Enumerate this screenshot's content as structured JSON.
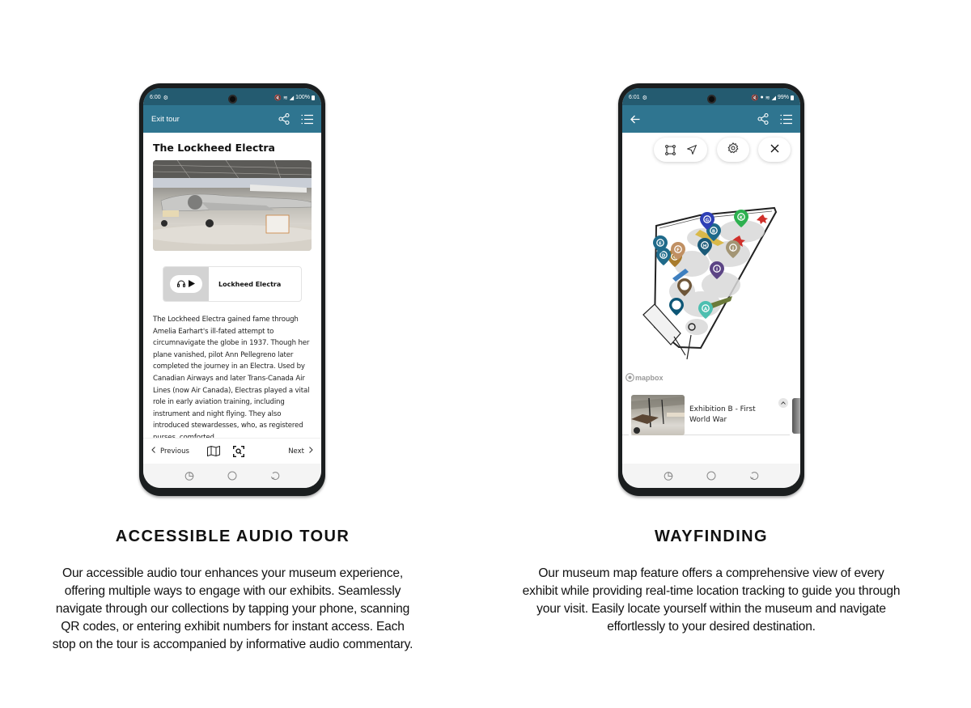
{
  "audio_tour_phone": {
    "status_bar": {
      "time": "6:00",
      "battery": "100%"
    },
    "app_bar": {
      "title": "Exit tour",
      "icons": [
        "share-icon",
        "list-icon"
      ]
    },
    "exhibit": {
      "title": "The Lockheed Electra",
      "image_alt": "Lockheed Electra aircraft on display",
      "audio_player": {
        "label": "Lockheed Electra",
        "icons": [
          "headphones-icon",
          "play-icon"
        ]
      },
      "description": "The Lockheed Electra gained fame through Amelia Earhart's ill-fated attempt to circumnavigate the globe in 1937. Though her plane vanished, pilot Ann Pellegreno later completed the journey in an Electra. Used by Canadian Airways and later Trans-Canada Air Lines (now Air Canada), Electras played a vital role in early aviation training, including instrument and night flying. They also introduced stewardesses, who, as registered nurses, comforted"
    },
    "bottom_nav": {
      "previous": "Previous",
      "next": "Next",
      "icons": [
        "chevron-left-icon",
        "map-icon",
        "scan-icon",
        "chevron-right-icon"
      ]
    },
    "system_nav": [
      "recents-icon",
      "home-icon",
      "back-icon"
    ]
  },
  "wayfinding_phone": {
    "status_bar": {
      "time": "6:01",
      "battery": "99%"
    },
    "app_bar": {
      "icons": [
        "back-arrow-icon",
        "share-icon",
        "list-icon"
      ]
    },
    "map_toolbar": {
      "icons": [
        "frame-icon",
        "navigate-icon",
        "settings-icon",
        "close-icon"
      ]
    },
    "map": {
      "attribution": "mapbox",
      "markers": [
        {
          "label": "A",
          "color": "#4dbfb0"
        },
        {
          "label": "B",
          "color": "#1f6a8a"
        },
        {
          "label": "C",
          "color": "#a87b2c"
        },
        {
          "label": "D",
          "color": "#1f6a8a"
        },
        {
          "label": "E",
          "color": "#1f6a8a"
        },
        {
          "label": "F",
          "color": "#c09063"
        },
        {
          "label": "G",
          "color": "#2e3fb6"
        },
        {
          "label": "H",
          "color": "#1a5a78"
        },
        {
          "label": "I",
          "color": "#5c4585"
        },
        {
          "label": "J",
          "color": "#a39574"
        },
        {
          "label": "K",
          "color": "#2db04f"
        },
        {
          "label": "",
          "color": "#6e5639"
        },
        {
          "label": "",
          "color": "#0d5676"
        }
      ]
    },
    "exhibit_card": {
      "title": "Exhibition B - First World War"
    },
    "system_nav": [
      "recents-icon",
      "home-icon",
      "back-icon"
    ]
  },
  "captions": {
    "audio_tour": {
      "heading": "ACCESSIBLE AUDIO TOUR",
      "body": "Our accessible audio tour enhances your museum experience, offering multiple ways to engage with our exhibits. Seamlessly navigate through our collections by tapping your phone, scanning QR codes, or entering exhibit numbers for instant access. Each stop on the tour is accompanied by informative audio commentary."
    },
    "wayfinding": {
      "heading": "WAYFINDING",
      "body": "Our museum map feature offers a comprehensive view of every exhibit  while providing real-time location tracking to guide you through your  visit. Easily locate yourself within the museum and navigate effortlessly to your desired destination."
    }
  },
  "colors": {
    "status_bar": "#245b70",
    "app_bar": "#2f7590",
    "phone_frame": "#1b1e1f"
  }
}
